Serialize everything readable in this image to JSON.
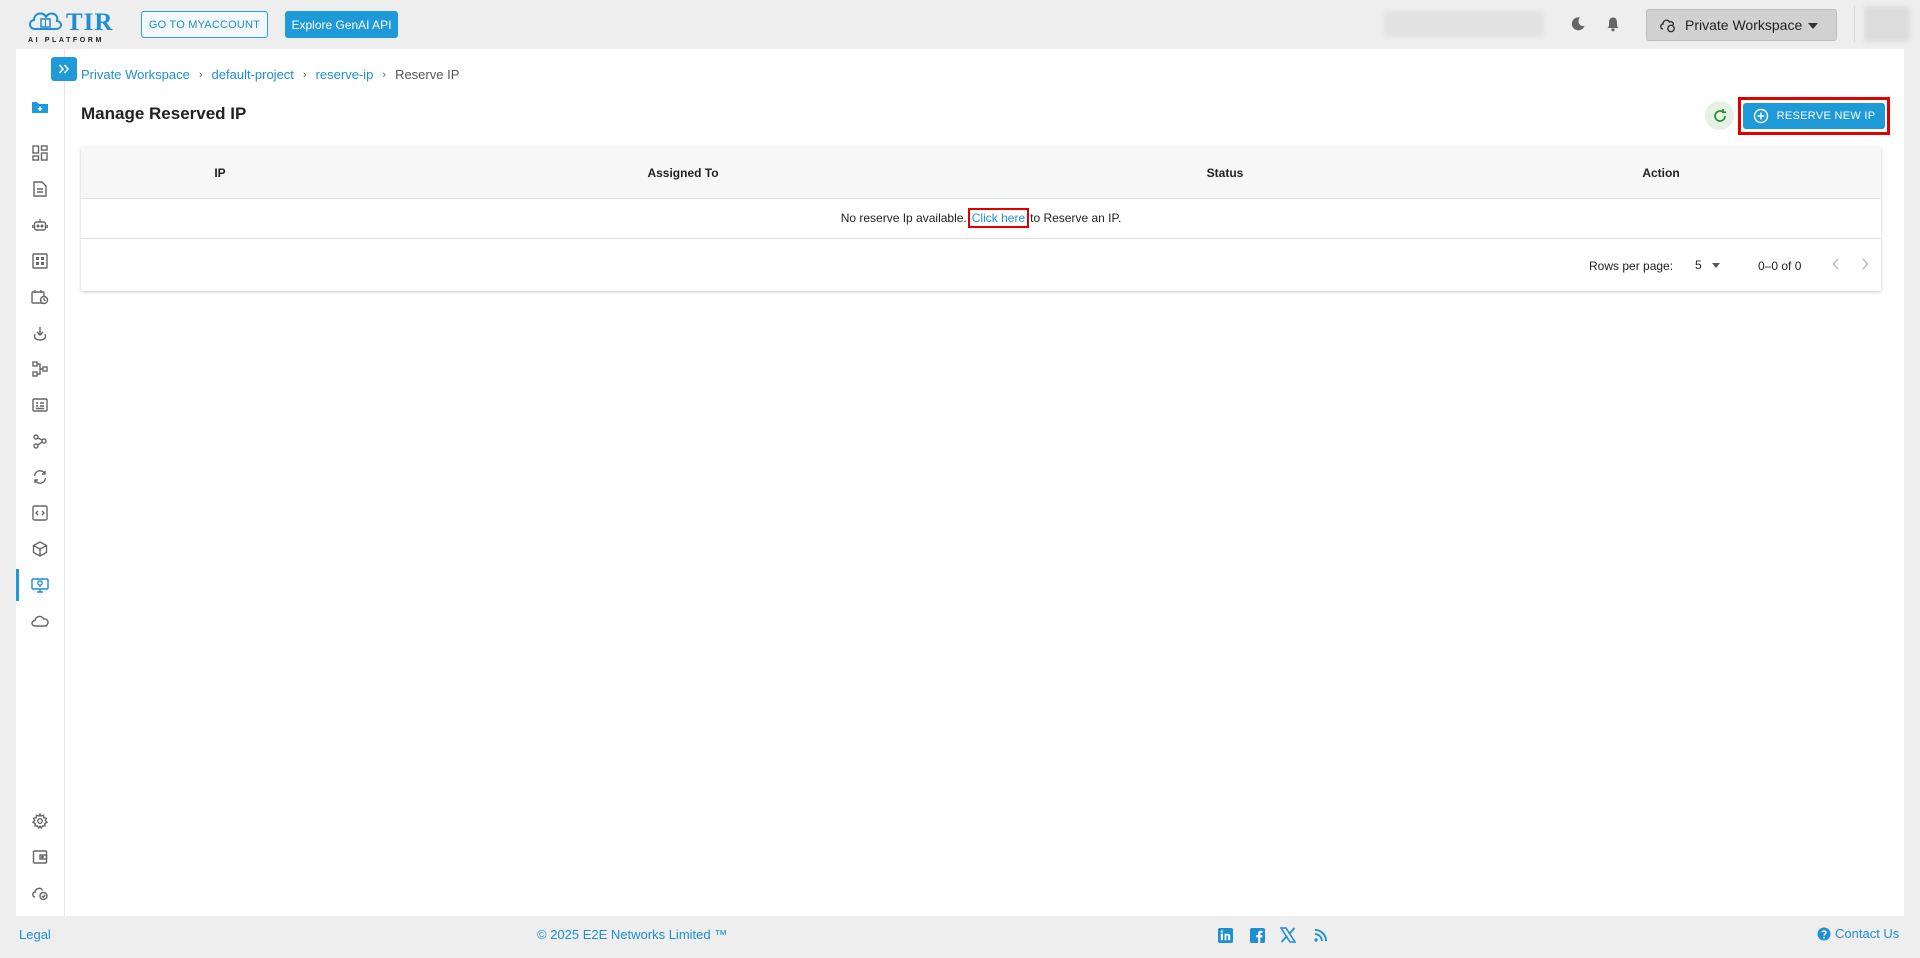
{
  "brand": {
    "logo_text": "TIR",
    "logo_subtext": "AI PLATFORM",
    "accent": "#1e9ad8"
  },
  "header": {
    "myaccount_label": "GO TO MYACCOUNT",
    "genai_label": "Explore GenAI API",
    "workspace_label": "Private Workspace",
    "icons": [
      "theme-toggle-icon",
      "notification-bell-icon",
      "workspace-icon",
      "chevron-down-icon"
    ]
  },
  "sidebar": {
    "items": [
      "folder-add-icon",
      "dashboard-icon",
      "document-icon",
      "robot-icon",
      "apps-grid-icon",
      "calendar-clock-icon",
      "deploy-icon",
      "pipeline-icon",
      "registry-icon",
      "share-network-icon",
      "sync-icon",
      "code-icon",
      "cube-icon",
      "reserve-ip-icon",
      "cloud-icon"
    ],
    "active_item": "reserve-ip-icon",
    "bottom_items": [
      "settings-gear-icon",
      "wallet-icon",
      "secure-cloud-icon"
    ]
  },
  "breadcrumb": {
    "items": [
      "Private Workspace",
      "default-project",
      "reserve-ip"
    ],
    "current": "Reserve IP"
  },
  "page": {
    "title": "Manage Reserved IP",
    "reserve_button_label": "RESERVE NEW IP"
  },
  "table": {
    "columns": [
      "IP",
      "Assigned To",
      "Status",
      "Action"
    ],
    "empty_text_before": "No reserve Ip available.",
    "empty_link": "Click here",
    "empty_text_after": "to Reserve an IP.",
    "rows_per_page_label": "Rows per page:",
    "rows_per_page_value": "5",
    "range_text": "0–0 of 0"
  },
  "footer": {
    "legal": "Legal",
    "copyright": "© 2025 E2E Networks Limited ™",
    "social": [
      "linkedin-icon",
      "facebook-icon",
      "x-twitter-icon",
      "rss-icon"
    ],
    "contact": "Contact Us"
  }
}
